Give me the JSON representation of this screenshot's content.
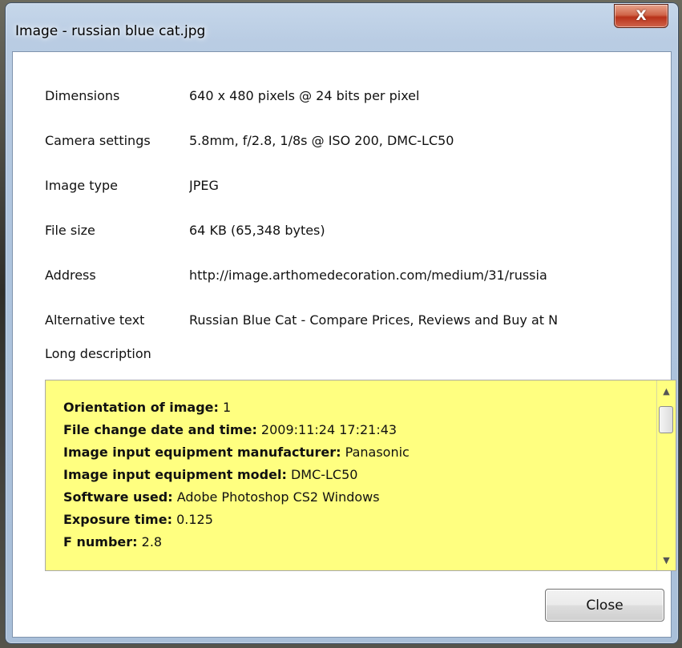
{
  "window": {
    "title": "Image - russian blue cat.jpg",
    "close_glyph": "X"
  },
  "properties": [
    {
      "label": "Dimensions",
      "value": "640 x 480 pixels @ 24 bits per pixel"
    },
    {
      "label": "Camera settings",
      "value": "5.8mm, f/2.8, 1/8s @ ISO 200, DMC-LC50"
    },
    {
      "label": "Image type",
      "value": "JPEG"
    },
    {
      "label": "File size",
      "value": "64 KB (65,348 bytes)"
    },
    {
      "label": "Address",
      "value": "http://image.arthomedecoration.com/medium/31/russia"
    },
    {
      "label": "Alternative text",
      "value": "Russian Blue Cat - Compare Prices, Reviews and Buy at N"
    }
  ],
  "long_description": {
    "label": "Long description",
    "lines": [
      {
        "key": "Orientation of image:",
        "value": " 1"
      },
      {
        "key": "File change date and time:",
        "value": " 2009:11:24 17:21:43"
      },
      {
        "key": "Image input equipment manufacturer:",
        "value": " Panasonic"
      },
      {
        "key": "Image input equipment model:",
        "value": " DMC-LC50"
      },
      {
        "key": "Software used:",
        "value": " Adobe Photoshop CS2 Windows"
      },
      {
        "key": "Exposure time:",
        "value": " 0.125"
      },
      {
        "key": "F number:",
        "value": " 2.8"
      }
    ]
  },
  "buttons": {
    "close_label": "Close"
  },
  "colors": {
    "description_background": "#ffff80",
    "title_close_red": "#c8412a"
  }
}
